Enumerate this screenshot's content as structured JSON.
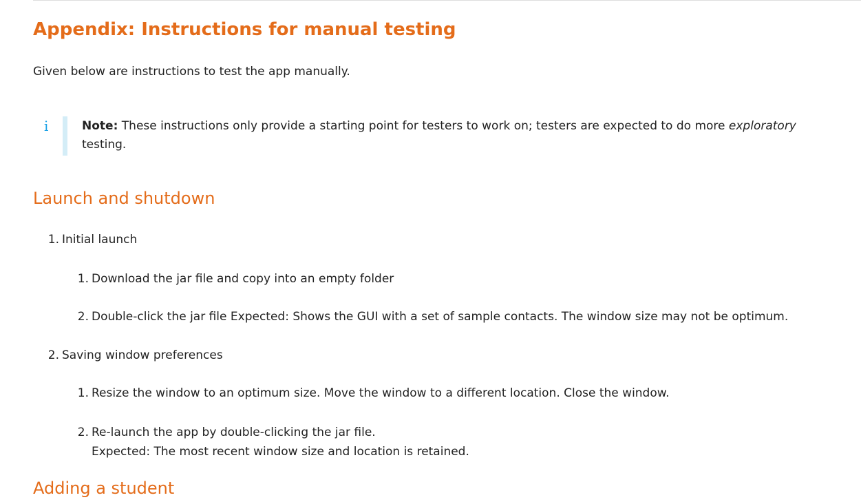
{
  "heading": "Appendix: Instructions for manual testing",
  "intro": "Given below are instructions to test the app manually.",
  "note": {
    "icon": "info-icon",
    "icon_glyph": "i",
    "label": "Note:",
    "text_line1": "These instructions only provide a starting point for testers to work on; testers are expected to do more",
    "emphasis": "exploratory",
    "text_line2": "testing."
  },
  "sections": [
    {
      "title": "Launch and shutdown",
      "items": [
        {
          "number": "1.",
          "label": "Initial launch",
          "subitems": [
            {
              "number": "1.",
              "text": "Download the jar file and copy into an empty folder"
            },
            {
              "number": "2.",
              "text": "Double-click the jar file Expected: Shows the GUI with a set of sample contacts. The window size may not be optimum."
            }
          ]
        },
        {
          "number": "2.",
          "label": "Saving window preferences",
          "subitems": [
            {
              "number": "1.",
              "text": "Resize the window to an optimum size. Move the window to a different location. Close the window."
            },
            {
              "number": "2.",
              "text": "Re-launch the app by double-clicking the jar file.",
              "expected": "Expected: The most recent window size and location is retained."
            }
          ]
        }
      ]
    },
    {
      "title": "Adding a student",
      "items": []
    }
  ],
  "colors": {
    "heading": "#e46c1a",
    "text": "#222222",
    "note_icon": "#19a1e6",
    "note_bar": "#d4edf7"
  }
}
